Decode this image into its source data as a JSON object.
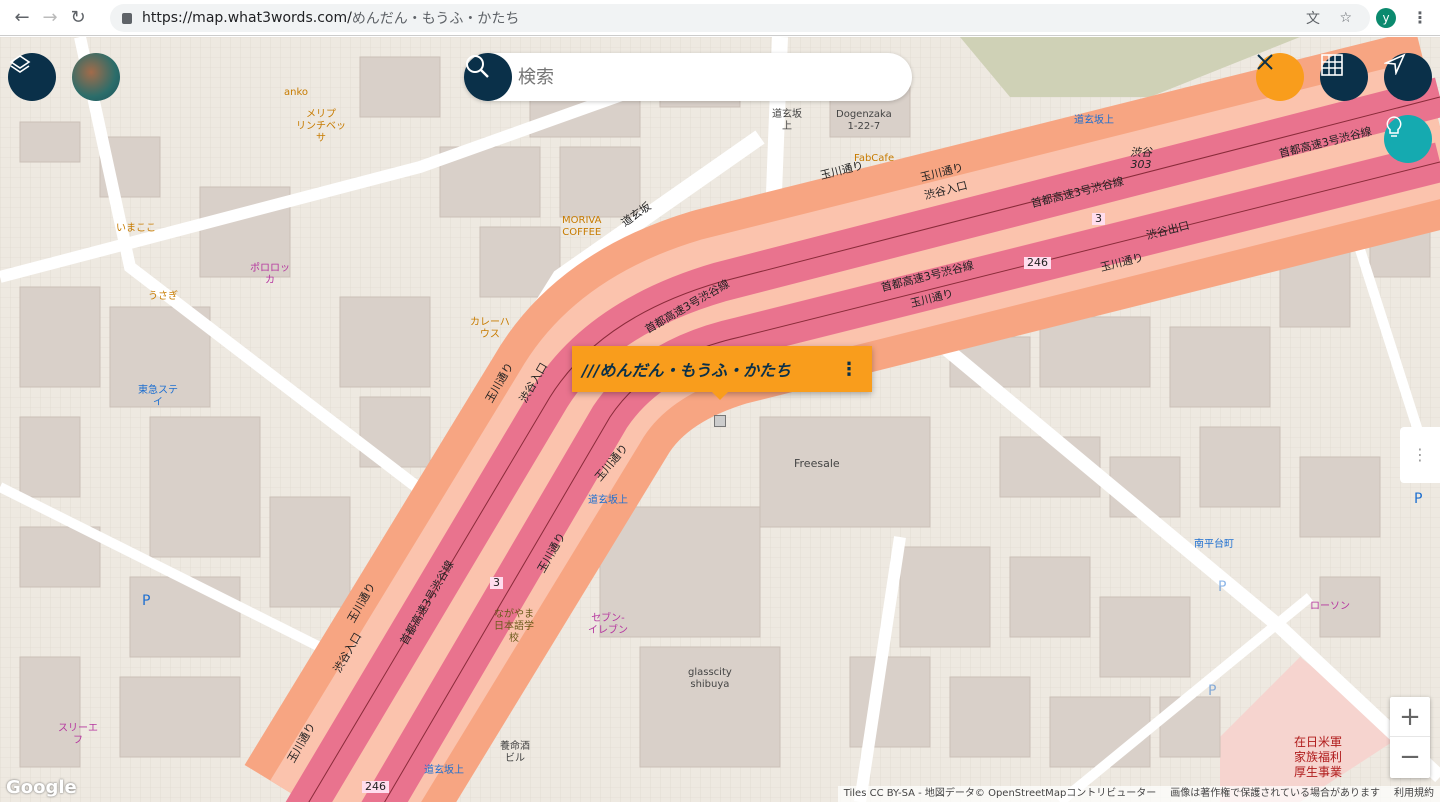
{
  "browser": {
    "url_host": "https://map.what3words.com/",
    "url_path": "めんだん・もうふ・かたち",
    "avatar": "y"
  },
  "search": {
    "placeholder": "検索"
  },
  "popup": {
    "address": "///めんだん・もうふ・かたち"
  },
  "zoom": {
    "in": "+",
    "out": "−"
  },
  "attribution": {
    "tiles": "Tiles CC BY-SA - 地図データ© OpenStreetMapコントリビューター",
    "copyright": "画像は著作権で保護されている場合があります",
    "terms": "利用規約"
  },
  "google": "Google",
  "labels": [
    "anko",
    "メリプ\nリンチベッ\nサ",
    "いまここ",
    "ポロロッ\nカ",
    "うさぎ",
    "東急ステ\nイ",
    "MORIVA\nCOFFEE",
    "カレーハ\nウス",
    "道玄坂\n上",
    "Dogenzaka\n1-22-7",
    "FabCafe",
    "道玄坂上",
    "道玄坂",
    "Freesale",
    "道玄坂上",
    "南平台町",
    "ローソン",
    "セブン-\nイレブン",
    "ながやま\n日本語学\n校",
    "glasscity\nshibuya",
    "養命酒\nビル",
    "道玄坂上",
    "スリーエ\nフ",
    "在日米軍\n家族福利\n厚生事業",
    "P",
    "P",
    "P",
    "P"
  ],
  "roads": [
    "玉川通り",
    "首都高速3号渋谷線",
    "渋谷入口",
    "玉川通り",
    "首都高速3号渋谷線",
    "渋谷出口",
    "玉川通り",
    "玉川通り",
    "首都高速3号渋谷線",
    "渋谷入口",
    "玉川通り",
    "首都高速3号渋谷線",
    "玉川通り",
    "渋谷入口",
    "首都高速3号渋谷線",
    "玉川通り",
    "玉川通り",
    "玉川通り",
    "渋谷\n303"
  ],
  "route_shields": [
    "3",
    "246",
    "3",
    "246"
  ]
}
